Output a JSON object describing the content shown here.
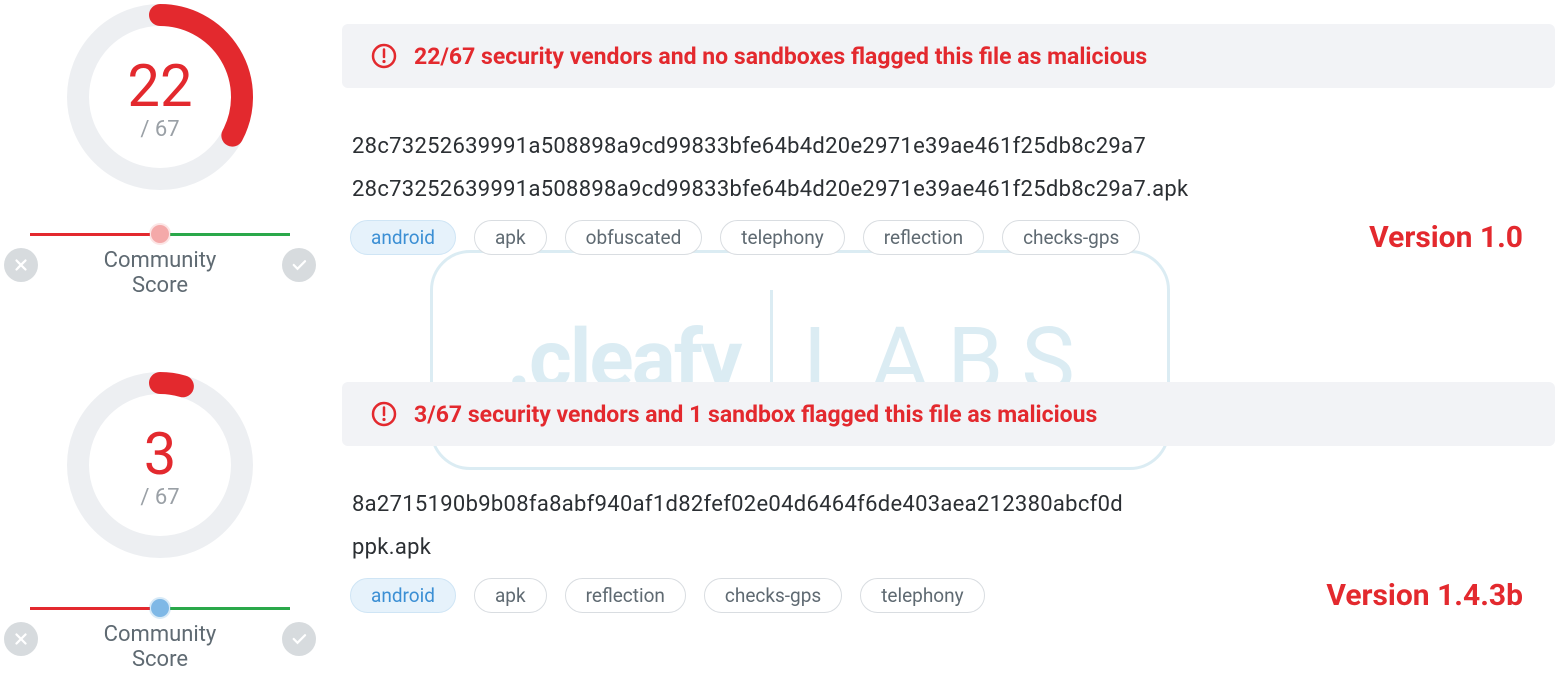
{
  "watermark": {
    "brand": ".cleafy",
    "labs": "LABS"
  },
  "scans": [
    {
      "score": "22",
      "total": "/ 67",
      "gauge_fraction": 0.328,
      "slider_color": "pink",
      "community_label_1": "Community",
      "community_label_2": "Score",
      "alert": "22/67 security vendors and no sandboxes flagged this file as malicious",
      "hash": "28c73252639991a508898a9cd99833bfe64b4d20e2971e39ae461f25db8c29a7",
      "filename": "28c73252639991a508898a9cd99833bfe64b4d20e2971e39ae461f25db8c29a7.apk",
      "tags": [
        "android",
        "apk",
        "obfuscated",
        "telephony",
        "reflection",
        "checks-gps"
      ],
      "version": "Version 1.0"
    },
    {
      "score": "3",
      "total": "/ 67",
      "gauge_fraction": 0.045,
      "slider_color": "blue",
      "community_label_1": "Community",
      "community_label_2": "Score",
      "alert": "3/67 security vendors and 1 sandbox flagged this file as malicious",
      "hash": "8a2715190b9b08fa8abf940af1d82fef02e04d6464f6de403aea212380abcf0d",
      "filename": "ppk.apk",
      "tags": [
        "android",
        "apk",
        "reflection",
        "checks-gps",
        "telephony"
      ],
      "version": "Version 1.4.3b"
    }
  ]
}
